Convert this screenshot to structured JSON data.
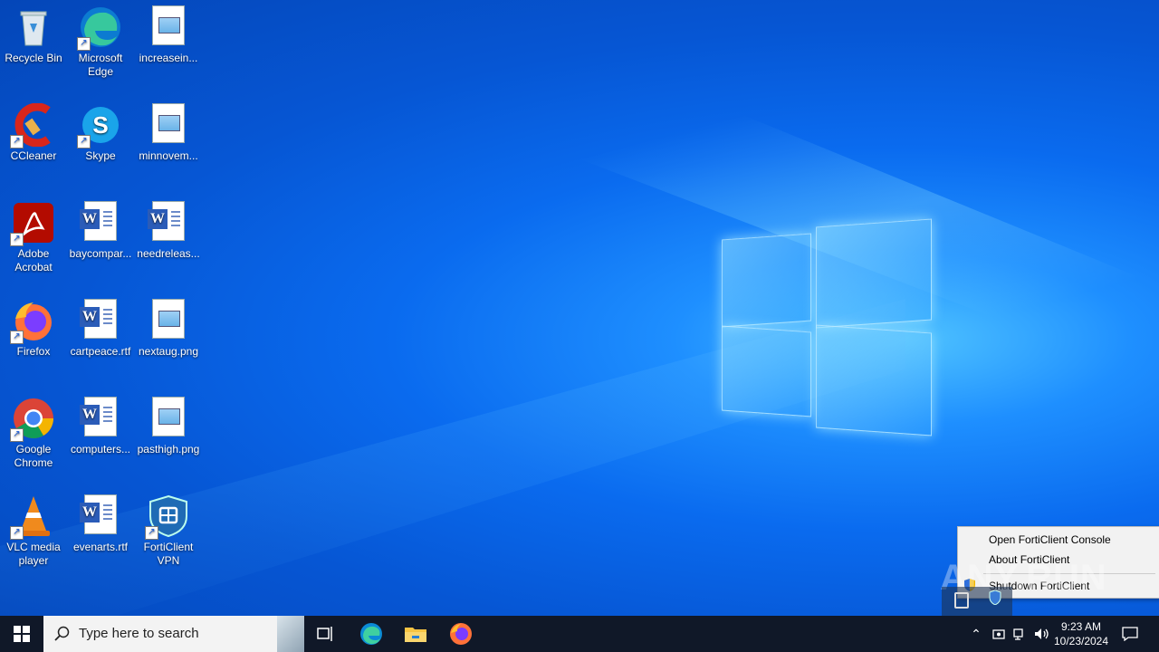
{
  "desktop": {
    "icons": [
      {
        "label": "Recycle Bin",
        "icon": "recycle-bin-icon"
      },
      {
        "label": "Microsoft Edge",
        "icon": "edge-icon"
      },
      {
        "label": "increasein...",
        "icon": "image-file-icon"
      },
      {
        "label": "CCleaner",
        "icon": "ccleaner-icon"
      },
      {
        "label": "Skype",
        "icon": "skype-icon"
      },
      {
        "label": "minnovem...",
        "icon": "image-file-icon"
      },
      {
        "label": "Adobe Acrobat",
        "icon": "acrobat-icon"
      },
      {
        "label": "baycompar...",
        "icon": "word-doc-icon"
      },
      {
        "label": "needreleas...",
        "icon": "word-doc-icon"
      },
      {
        "label": "Firefox",
        "icon": "firefox-icon"
      },
      {
        "label": "cartpeace.rtf",
        "icon": "word-doc-icon"
      },
      {
        "label": "nextaug.png",
        "icon": "image-file-icon"
      },
      {
        "label": "Google Chrome",
        "icon": "chrome-icon"
      },
      {
        "label": "computers...",
        "icon": "word-doc-icon"
      },
      {
        "label": "pasthigh.png",
        "icon": "image-file-icon"
      },
      {
        "label": "VLC media player",
        "icon": "vlc-icon"
      },
      {
        "label": "evenarts.rtf",
        "icon": "word-doc-icon"
      },
      {
        "label": "FortiClient VPN",
        "icon": "forticlient-icon"
      }
    ]
  },
  "context_menu": {
    "items": [
      "Open FortiClient Console",
      "About FortiClient",
      "Shutdown FortiClient"
    ]
  },
  "watermark": "ANY.RUN",
  "taskbar": {
    "search_placeholder": "Type here to search",
    "clock_time": "9:23 AM",
    "clock_date": "10/23/2024"
  },
  "colors": {
    "accent": "#0a6bef",
    "taskbar": "#101828"
  }
}
